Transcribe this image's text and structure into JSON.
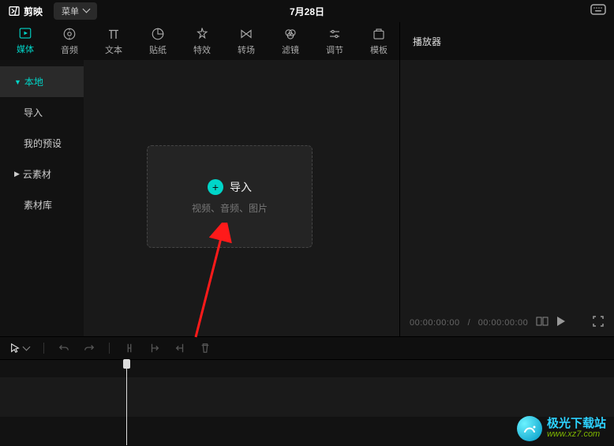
{
  "topbar": {
    "app_name": "剪映",
    "menu_label": "菜单",
    "date": "7月28日"
  },
  "tabs": [
    {
      "label": "媒体"
    },
    {
      "label": "音频"
    },
    {
      "label": "文本"
    },
    {
      "label": "贴纸"
    },
    {
      "label": "特效"
    },
    {
      "label": "转场"
    },
    {
      "label": "滤镜"
    },
    {
      "label": "调节"
    },
    {
      "label": "模板"
    }
  ],
  "player": {
    "header": "播放器",
    "time_current": "00:00:00:00",
    "time_separator": "/",
    "time_total": "00:00:00:00"
  },
  "sidebar": [
    {
      "label": "本地",
      "expandable": true
    },
    {
      "label": "导入",
      "expandable": false
    },
    {
      "label": "我的预设",
      "expandable": false
    },
    {
      "label": "云素材",
      "expandable": true
    },
    {
      "label": "素材库",
      "expandable": false
    }
  ],
  "import_card": {
    "title": "导入",
    "subtitle": "视频、音频、图片"
  },
  "watermark": {
    "name": "极光下载站",
    "url": "www.xz7.com"
  }
}
